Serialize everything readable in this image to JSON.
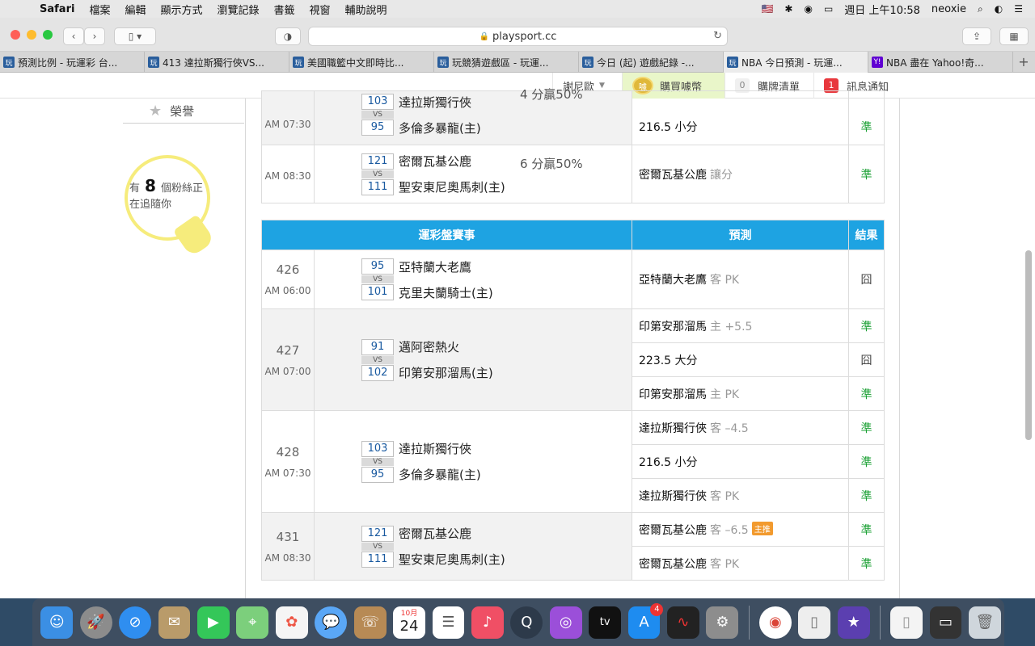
{
  "menubar": {
    "app": "Safari",
    "items": [
      "檔案",
      "編輯",
      "顯示方式",
      "瀏覽記錄",
      "書籤",
      "視窗",
      "輔助說明"
    ],
    "clock": "週日 上午10:58",
    "user": "neoxie"
  },
  "browser": {
    "url": "playsport.cc",
    "tabs": [
      {
        "fav": "玩",
        "title": "預測比例 - 玩運彩 台..."
      },
      {
        "fav": "玩",
        "title": "413 達拉斯獨行俠VS..."
      },
      {
        "fav": "玩",
        "title": "美國職籃中文即時比..."
      },
      {
        "fav": "玩",
        "title": "玩競猜遊戲區 - 玩運..."
      },
      {
        "fav": "玩",
        "title": "今日 (起) 遊戲紀錄 -..."
      },
      {
        "fav": "玩",
        "title": "NBA 今日預測 - 玩運..."
      },
      {
        "fav": "Y!",
        "title": "NBA 盡在 Yahoo!奇..."
      }
    ]
  },
  "sitebar": {
    "user": "謝尼歐",
    "buy": "購買噱幣",
    "coin": "噱",
    "cart_count": "0",
    "cart": "購牌清單",
    "notice_count": "1",
    "notice": "訊息通知"
  },
  "sidebar": {
    "honor": "榮譽",
    "fans_pre": "有",
    "fans_count": "8",
    "fans_mid": "個粉絲正",
    "fans_post": "在追隨你"
  },
  "prev_table": {
    "rows": [
      {
        "time": "AM 07:30",
        "away": "達拉斯獨行俠",
        "away_score": "103",
        "home": "多倫多暴龍(主)",
        "home_score": "95",
        "record": "4 分贏50%",
        "pick": "216.5 小分",
        "pick_sub": "",
        "result": "準"
      },
      {
        "time": "AM 08:30",
        "away": "密爾瓦基公鹿",
        "away_score": "121",
        "home": "聖安東尼奧馬刺(主)",
        "home_score": "111",
        "record": "6 分贏50%",
        "pick": "密爾瓦基公鹿",
        "pick_sub": "讓分",
        "result": "準"
      }
    ]
  },
  "table": {
    "headers": {
      "game": "運彩盤賽事",
      "pick": "預測",
      "result": "結果"
    },
    "vs": "VS",
    "games": [
      {
        "no": "426",
        "time": "AM 06:00",
        "away": "亞特蘭大老鷹",
        "away_score": "95",
        "home": "克里夫蘭騎士(主)",
        "home_score": "101",
        "picks": [
          {
            "team": "亞特蘭大老鷹",
            "sub": "客 PK",
            "hot": "",
            "result": "囧"
          }
        ]
      },
      {
        "no": "427",
        "time": "AM 07:00",
        "away": "邁阿密熱火",
        "away_score": "91",
        "home": "印第安那溜馬(主)",
        "home_score": "102",
        "picks": [
          {
            "team": "印第安那溜馬",
            "sub": "主 +5.5",
            "hot": "",
            "result": "準"
          },
          {
            "team": "223.5 大分",
            "sub": "",
            "hot": "",
            "result": "囧"
          },
          {
            "team": "印第安那溜馬",
            "sub": "主 PK",
            "hot": "",
            "result": "準"
          }
        ]
      },
      {
        "no": "428",
        "time": "AM 07:30",
        "away": "達拉斯獨行俠",
        "away_score": "103",
        "home": "多倫多暴龍(主)",
        "home_score": "95",
        "picks": [
          {
            "team": "達拉斯獨行俠",
            "sub": "客 –4.5",
            "hot": "",
            "result": "準"
          },
          {
            "team": "216.5 小分",
            "sub": "",
            "hot": "",
            "result": "準"
          },
          {
            "team": "達拉斯獨行俠",
            "sub": "客 PK",
            "hot": "",
            "result": "準"
          }
        ]
      },
      {
        "no": "431",
        "time": "AM 08:30",
        "away": "密爾瓦基公鹿",
        "away_score": "121",
        "home": "聖安東尼奧馬刺(主)",
        "home_score": "111",
        "picks": [
          {
            "team": "密爾瓦基公鹿",
            "sub": "客 –6.5",
            "hot": "主推",
            "result": "準"
          },
          {
            "team": "密爾瓦基公鹿",
            "sub": "客 PK",
            "hot": "",
            "result": "準"
          }
        ]
      }
    ]
  },
  "dock": {
    "appstore_badge": "4",
    "calendar_month": "10月",
    "calendar_day": "24",
    "tv": "tv"
  },
  "colors": {
    "header": "#1ea3e2",
    "ok": "#1aa033",
    "hot": "#f29a2e"
  }
}
